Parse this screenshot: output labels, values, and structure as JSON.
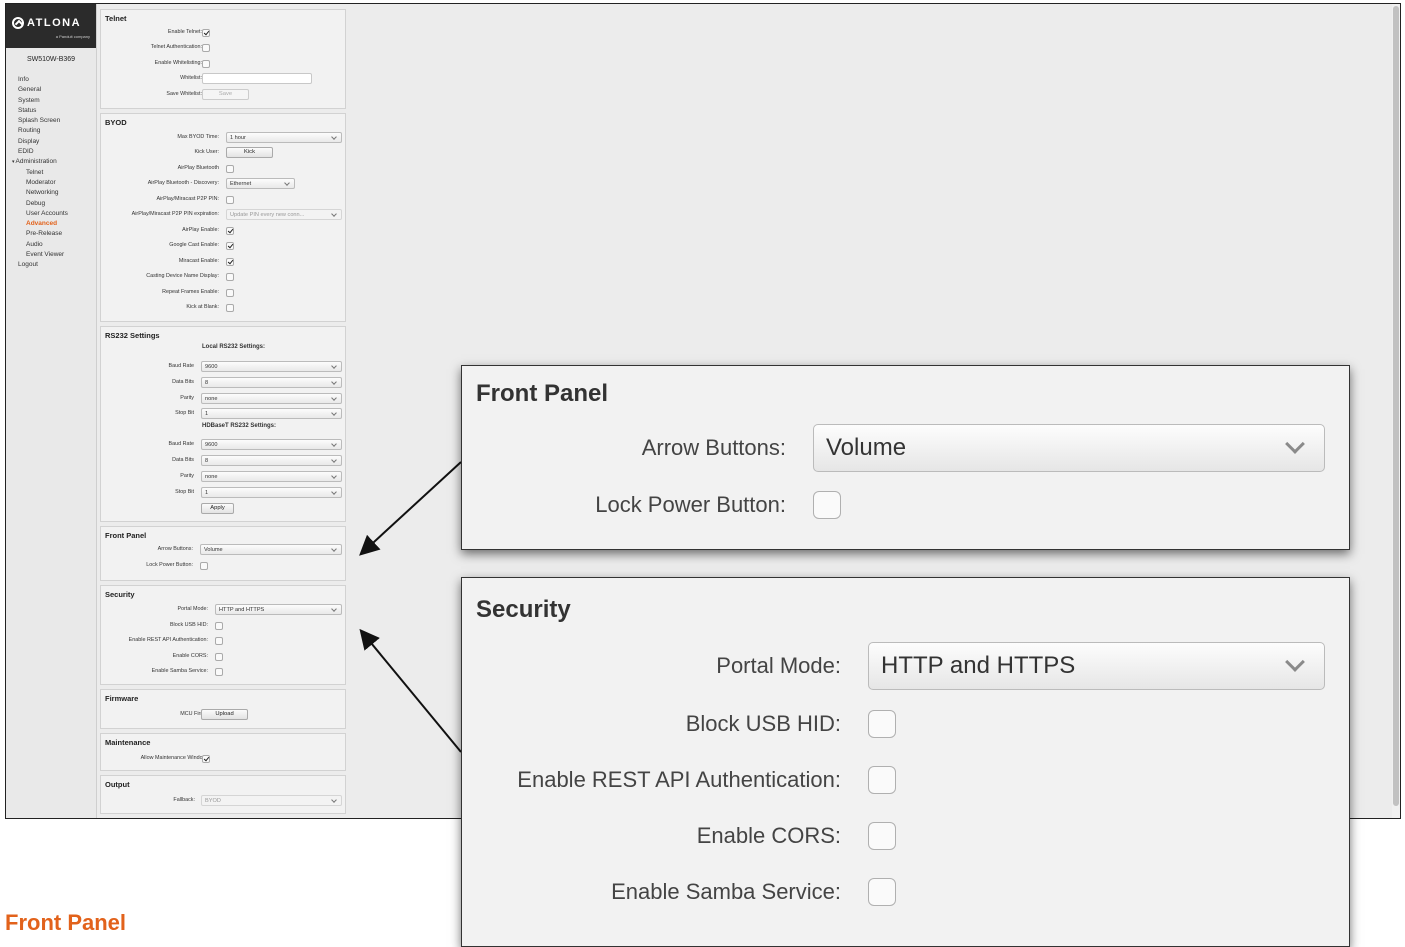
{
  "app": {
    "logo": "ATLONA",
    "logo_sub": "a Panduit company",
    "device_name": "SW510W-B369"
  },
  "nav": {
    "items": [
      "Info",
      "General",
      "System",
      "Status",
      "Splash Screen",
      "Routing",
      "Display",
      "EDID",
      "Administration"
    ],
    "admin_items": [
      "Telnet",
      "Moderator",
      "Networking",
      "Debug",
      "User Accounts",
      "Advanced",
      "Pre-Release",
      "Audio",
      "Event Viewer"
    ],
    "logout": "Logout",
    "active": "Advanced"
  },
  "telnet": {
    "title": "Telnet",
    "enable_telnet": "Enable Telnet:",
    "telnet_auth": "Telnet Authentication:",
    "enable_whitelisting": "Enable Whitelisting:",
    "whitelist": "Whitelist:",
    "save_whitelist": "Save Whitelist:",
    "save_button": "Save"
  },
  "byod": {
    "title": "BYOD",
    "max_time_label": "Max BYOD Time:",
    "max_time_value": "1 hour",
    "kick_user_label": "Kick User:",
    "kick_button": "Kick",
    "airplay_bt": "AirPlay Bluetooth",
    "airplay_bt_discovery": "AirPlay Bluetooth - Discovery:",
    "airplay_bt_discovery_value": "Ethernet",
    "p2p_pin": "AirPlay/Miracast P2P PIN:",
    "p2p_pin_exp": "AirPlay/Miracast P2P PIN expiration:",
    "p2p_pin_exp_value": "Update PIN every new conn...",
    "airplay_enable": "AirPlay Enable:",
    "google_cast": "Google Cast Enable:",
    "miracast": "Miracast Enable:",
    "casting_name": "Casting Device Name Display:",
    "repeat_frames": "Repeat Frames Enable:",
    "kick_blank": "Kick at Blank:"
  },
  "rs232": {
    "title": "RS232 Settings",
    "local_header": "Local RS232 Settings:",
    "hdbaset_header": "HDBaseT RS232 Settings:",
    "baud_label": "Baud Rate",
    "data_bits_label": "Data Bits",
    "parity_label": "Parity",
    "stop_bit_label": "Stop Bit",
    "baud_value": "9600",
    "data_bits_value": "8",
    "parity_value": "none",
    "stop_bit_value": "1",
    "apply_button": "Apply"
  },
  "front_panel": {
    "title": "Front Panel",
    "arrow_buttons_label": "Arrow Buttons:",
    "arrow_buttons_value": "Volume",
    "lock_power_label": "Lock Power Button:"
  },
  "security": {
    "title": "Security",
    "portal_mode_label": "Portal Mode:",
    "portal_mode_value": "HTTP and HTTPS",
    "block_usb_label": "Block USB HID:",
    "rest_api_label": "Enable REST API Authentication:",
    "cors_label": "Enable CORS:",
    "samba_label": "Enable Samba Service:"
  },
  "firmware": {
    "title": "Firmware",
    "mcu_label": "MCU Firmware:",
    "upload_button": "Upload"
  },
  "maintenance": {
    "title": "Maintenance",
    "allow_label": "Allow Maintenance Window:"
  },
  "output": {
    "title": "Output",
    "fallback_label": "Fallback:",
    "fallback_value": "BYOD"
  },
  "zoom_front_panel": {
    "title": "Front Panel",
    "arrow_buttons_label": "Arrow Buttons:",
    "arrow_buttons_value": "Volume",
    "lock_power_label": "Lock Power Button:"
  },
  "zoom_security": {
    "title": "Security",
    "portal_mode_label": "Portal Mode:",
    "portal_mode_value": "HTTP and HTTPS",
    "block_usb_label": "Block USB HID:",
    "rest_api_label": "Enable REST API Authentication:",
    "cors_label": "Enable CORS:",
    "samba_label": "Enable Samba Service:"
  },
  "page_heading": "Front Panel",
  "colors": {
    "accent": "#e2621b",
    "logo_bar": "#2b2b2b",
    "panel_bg": "#f2f2f2"
  }
}
